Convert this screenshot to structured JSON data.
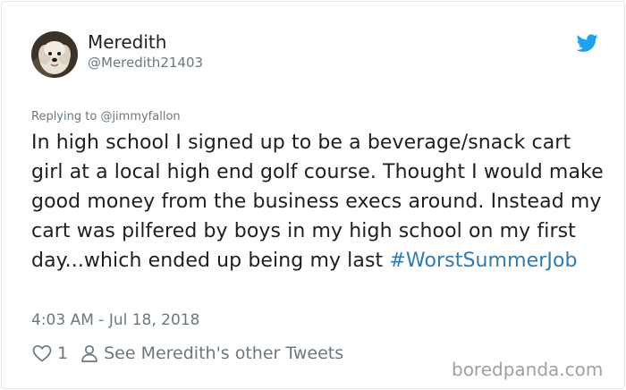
{
  "author": {
    "display_name": "Meredith",
    "handle": "@Meredith21403",
    "avatar": "avatar-dog-photo"
  },
  "icons": {
    "brand": "twitter-bird-icon",
    "like": "heart-outline-icon",
    "profile": "person-outline-icon"
  },
  "reply": {
    "prefix": "Replying to ",
    "target": "@jimmyfallon"
  },
  "tweet": {
    "text": "In high school I signed up to be a beverage/snack cart girl at a local high end golf course. Thought I would make good money from the business execs around. Instead my cart was pilfered by boys in my high school on my first day...which ended up being my last ",
    "hashtag": "#WorstSummerJob"
  },
  "timestamp": "4:03 AM - Jul 18, 2018",
  "actions": {
    "like_count": "1",
    "see_more": "See Meredith's other Tweets"
  },
  "watermark": "boredpanda.com",
  "colors": {
    "text": "#1c2022",
    "muted": "#697882",
    "link": "#2b7bb9",
    "brand": "#1da1f2"
  }
}
